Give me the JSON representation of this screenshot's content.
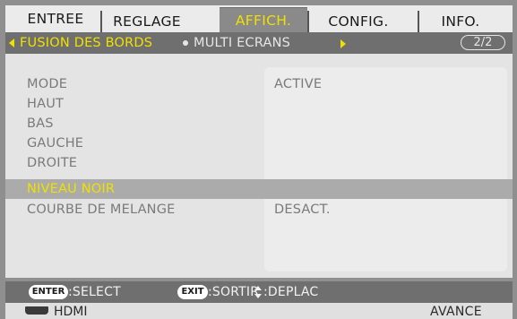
{
  "tabs": [
    {
      "label": "ENTREE",
      "active": false
    },
    {
      "label": "REGLAGE",
      "active": false
    },
    {
      "label": "AFFICH.",
      "active": true
    },
    {
      "label": "CONFIG.",
      "active": false
    },
    {
      "label": "INFO.",
      "active": false
    }
  ],
  "subheader": {
    "breadcrumb_active": "FUSION DES BORDS",
    "breadcrumb_next": "MULTI ECRANS",
    "page_indicator": "2/2"
  },
  "menu": {
    "rows": [
      {
        "label": "MODE",
        "value": "ACTIVE",
        "selected": false
      },
      {
        "label": "HAUT",
        "value": "",
        "selected": false
      },
      {
        "label": "BAS",
        "value": "",
        "selected": false
      },
      {
        "label": "GAUCHE",
        "value": "",
        "selected": false
      },
      {
        "label": "DROITE",
        "value": "",
        "selected": false
      },
      {
        "label": "NIVEAU NOIR",
        "value": "",
        "selected": true
      },
      {
        "label": "COURBE DE MELANGE",
        "value": "DESACT.",
        "selected": false
      }
    ]
  },
  "helpbar": {
    "enter_key": "ENTER",
    "enter_hint": ":SELECT",
    "exit_key": "EXIT",
    "exit_hint": ":SORTIR",
    "move_hint": ":DEPLAC"
  },
  "status": {
    "source": "HDMI",
    "mode": "AVANCE"
  },
  "colors": {
    "accent": "#f0e000",
    "menu_bg": "#e4e4e4",
    "bar_bg": "#6f6f6f",
    "selected_row": "#ababab"
  },
  "icons": {
    "left_arrow": "left-arrow-icon",
    "right_arrow": "right-arrow-icon",
    "move": "updown-arrows-icon",
    "source": "hdmi-connector-icon"
  }
}
